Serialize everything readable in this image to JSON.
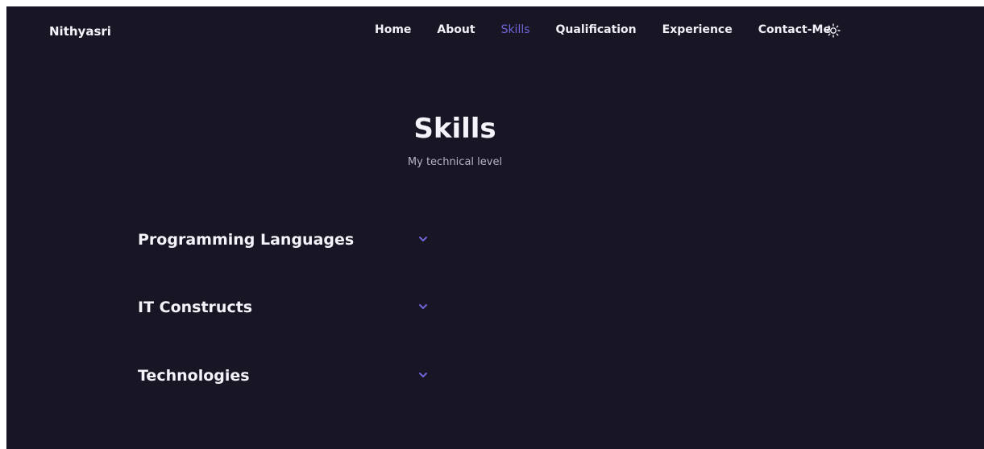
{
  "header": {
    "brand": "Nithyasri",
    "nav": {
      "home": "Home",
      "about": "About",
      "skills": "Skills",
      "qualification": "Qualification",
      "experience": "Experience",
      "contact": "Contact-Me"
    },
    "active_nav": "Skills",
    "theme_icon": "sun-icon"
  },
  "section": {
    "title": "Skills",
    "subtitle": "My technical level"
  },
  "categories": [
    {
      "label": "Programming Languages",
      "icon": "chevron-down-icon"
    },
    {
      "label": "IT Constructs",
      "icon": "chevron-down-icon"
    },
    {
      "label": "Technologies",
      "icon": "chevron-down-icon"
    }
  ],
  "colors": {
    "background": "#181624",
    "accent": "#6d65d8",
    "text": "#f4f3fa",
    "muted_text": "#b6b3c8"
  }
}
